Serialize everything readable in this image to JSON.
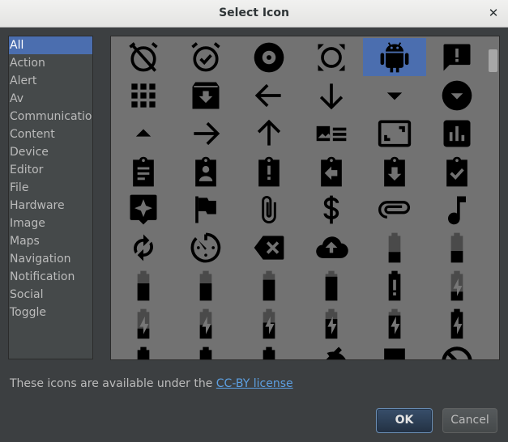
{
  "dialog": {
    "title": "Select Icon",
    "close_glyph": "✕"
  },
  "categories": [
    {
      "label": "All",
      "selected": true
    },
    {
      "label": "Action"
    },
    {
      "label": "Alert"
    },
    {
      "label": "Av"
    },
    {
      "label": "Communication"
    },
    {
      "label": "Content"
    },
    {
      "label": "Device"
    },
    {
      "label": "Editor"
    },
    {
      "label": "File"
    },
    {
      "label": "Hardware"
    },
    {
      "label": "Image"
    },
    {
      "label": "Maps"
    },
    {
      "label": "Navigation"
    },
    {
      "label": "Notification"
    },
    {
      "label": "Social"
    },
    {
      "label": "Toggle"
    }
  ],
  "icons": [
    [
      "alarm-off-icon",
      "alarm-on-icon",
      "album-icon",
      "all-out-icon",
      "android-icon",
      "announcement-icon"
    ],
    [
      "apps-icon",
      "archive-icon",
      "arrow-back-icon",
      "arrow-downward-icon",
      "arrow-drop-down-icon",
      "arrow-drop-down-circle-icon"
    ],
    [
      "arrow-drop-up-icon",
      "arrow-forward-icon",
      "arrow-upward-icon",
      "art-track-icon",
      "aspect-ratio-icon",
      "assessment-icon"
    ],
    [
      "assignment-icon",
      "assignment-ind-icon",
      "assignment-late-icon",
      "assignment-return-icon",
      "assignment-returned-icon",
      "assignment-turned-in-icon"
    ],
    [
      "assistant-icon",
      "assistant-photo-icon",
      "attach-file-icon",
      "attach-money-icon",
      "attachment-icon",
      "audiotrack-icon"
    ],
    [
      "autorenew-icon",
      "av-timer-icon",
      "backspace-icon",
      "backup-icon",
      "battery-20-icon",
      "battery-30-icon"
    ],
    [
      "battery-50-icon",
      "battery-60-icon",
      "battery-80-icon",
      "battery-90-icon",
      "battery-alert-icon",
      "battery-charging-20-icon"
    ],
    [
      "battery-charging-30-icon",
      "battery-charging-50-icon",
      "battery-charging-60-icon",
      "battery-charging-80-icon",
      "battery-charging-90-icon",
      "battery-charging-full-icon"
    ],
    [
      "battery-full-icon",
      "battery-std-icon",
      "battery-unknown-icon",
      "beach-access-icon",
      "beenhere-icon",
      "block-icon"
    ]
  ],
  "selected_icon": "android-icon",
  "colors": {
    "accent": "#4b6eaf",
    "icon_fill": "#000000",
    "grid_bg": "#727272",
    "dialog_bg": "#3c3f41",
    "link": "#5da0e2"
  },
  "footer": {
    "notice_prefix": "These icons are available under the ",
    "license_link": "CC-BY license"
  },
  "buttons": {
    "ok": "OK",
    "cancel": "Cancel"
  }
}
